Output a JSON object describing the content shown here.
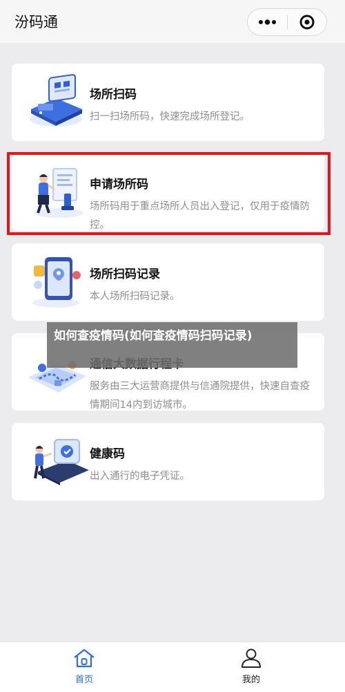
{
  "header": {
    "title": "汾码通",
    "more_icon": "more-dots-icon",
    "close_icon": "target-close-icon"
  },
  "cards": [
    {
      "title": "场所扫码",
      "desc": "扫一扫场所码，快速完成场所登记。",
      "icon": "scan-terminal-illustration"
    },
    {
      "title": "申请场所码",
      "desc": "场所码用于重点场所人员出入登记，仅用于疫情防控。",
      "icon": "person-document-illustration"
    },
    {
      "title": "场所扫码记录",
      "desc": "本人场所扫码记录。",
      "icon": "phone-location-illustration"
    },
    {
      "title": "通信大数据行程卡",
      "desc": "服务由三大运营商提供与信通院提供，快速自查疫情期间14内到访城市。",
      "icon": "route-map-illustration"
    },
    {
      "title": "健康码",
      "desc": "出入通行的电子凭证。",
      "icon": "person-health-badge-illustration"
    }
  ],
  "overlay": {
    "text": "如何查疫情码(如何查疫情码扫码记录)"
  },
  "tabbar": {
    "home_label": "首页",
    "mine_label": "我的",
    "active_color": "#2a69f0",
    "inactive_color": "#222222"
  },
  "colors": {
    "highlight": "#e3141b",
    "background": "#ececee",
    "accent": "#2a69f0"
  }
}
